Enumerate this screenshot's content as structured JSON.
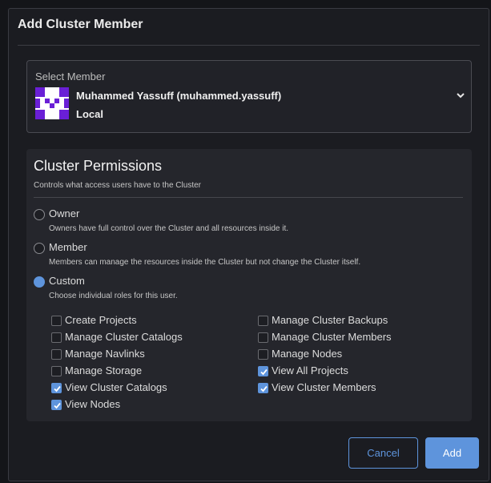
{
  "modal": {
    "title": "Add Cluster Member"
  },
  "member_select": {
    "label": "Select Member",
    "name": "Muhammed Yassuff (muhammed.yassuff)",
    "provider": "Local"
  },
  "permissions": {
    "title": "Cluster Permissions",
    "subtitle": "Controls what access users have to the Cluster",
    "roles": [
      {
        "label": "Owner",
        "desc": "Owners have full control over the Cluster and all resources inside it.",
        "selected": false
      },
      {
        "label": "Member",
        "desc": "Members can manage the resources inside the Cluster but not change the Cluster itself.",
        "selected": false
      },
      {
        "label": "Custom",
        "desc": "Choose individual roles for this user.",
        "selected": true
      }
    ],
    "custom_left": [
      {
        "label": "Create Projects",
        "checked": false
      },
      {
        "label": "Manage Cluster Catalogs",
        "checked": false
      },
      {
        "label": "Manage Navlinks",
        "checked": false
      },
      {
        "label": "Manage Storage",
        "checked": false
      },
      {
        "label": "View Cluster Catalogs",
        "checked": true
      },
      {
        "label": "View Nodes",
        "checked": true
      }
    ],
    "custom_right": [
      {
        "label": "Manage Cluster Backups",
        "checked": false
      },
      {
        "label": "Manage Cluster Members",
        "checked": false
      },
      {
        "label": "Manage Nodes",
        "checked": false
      },
      {
        "label": "View All Projects",
        "checked": true
      },
      {
        "label": "View Cluster Members",
        "checked": true
      }
    ]
  },
  "buttons": {
    "cancel": "Cancel",
    "add": "Add"
  },
  "colors": {
    "accent": "#5e94dc",
    "avatar": "#6a1fd6",
    "background": "#1b1c21"
  }
}
